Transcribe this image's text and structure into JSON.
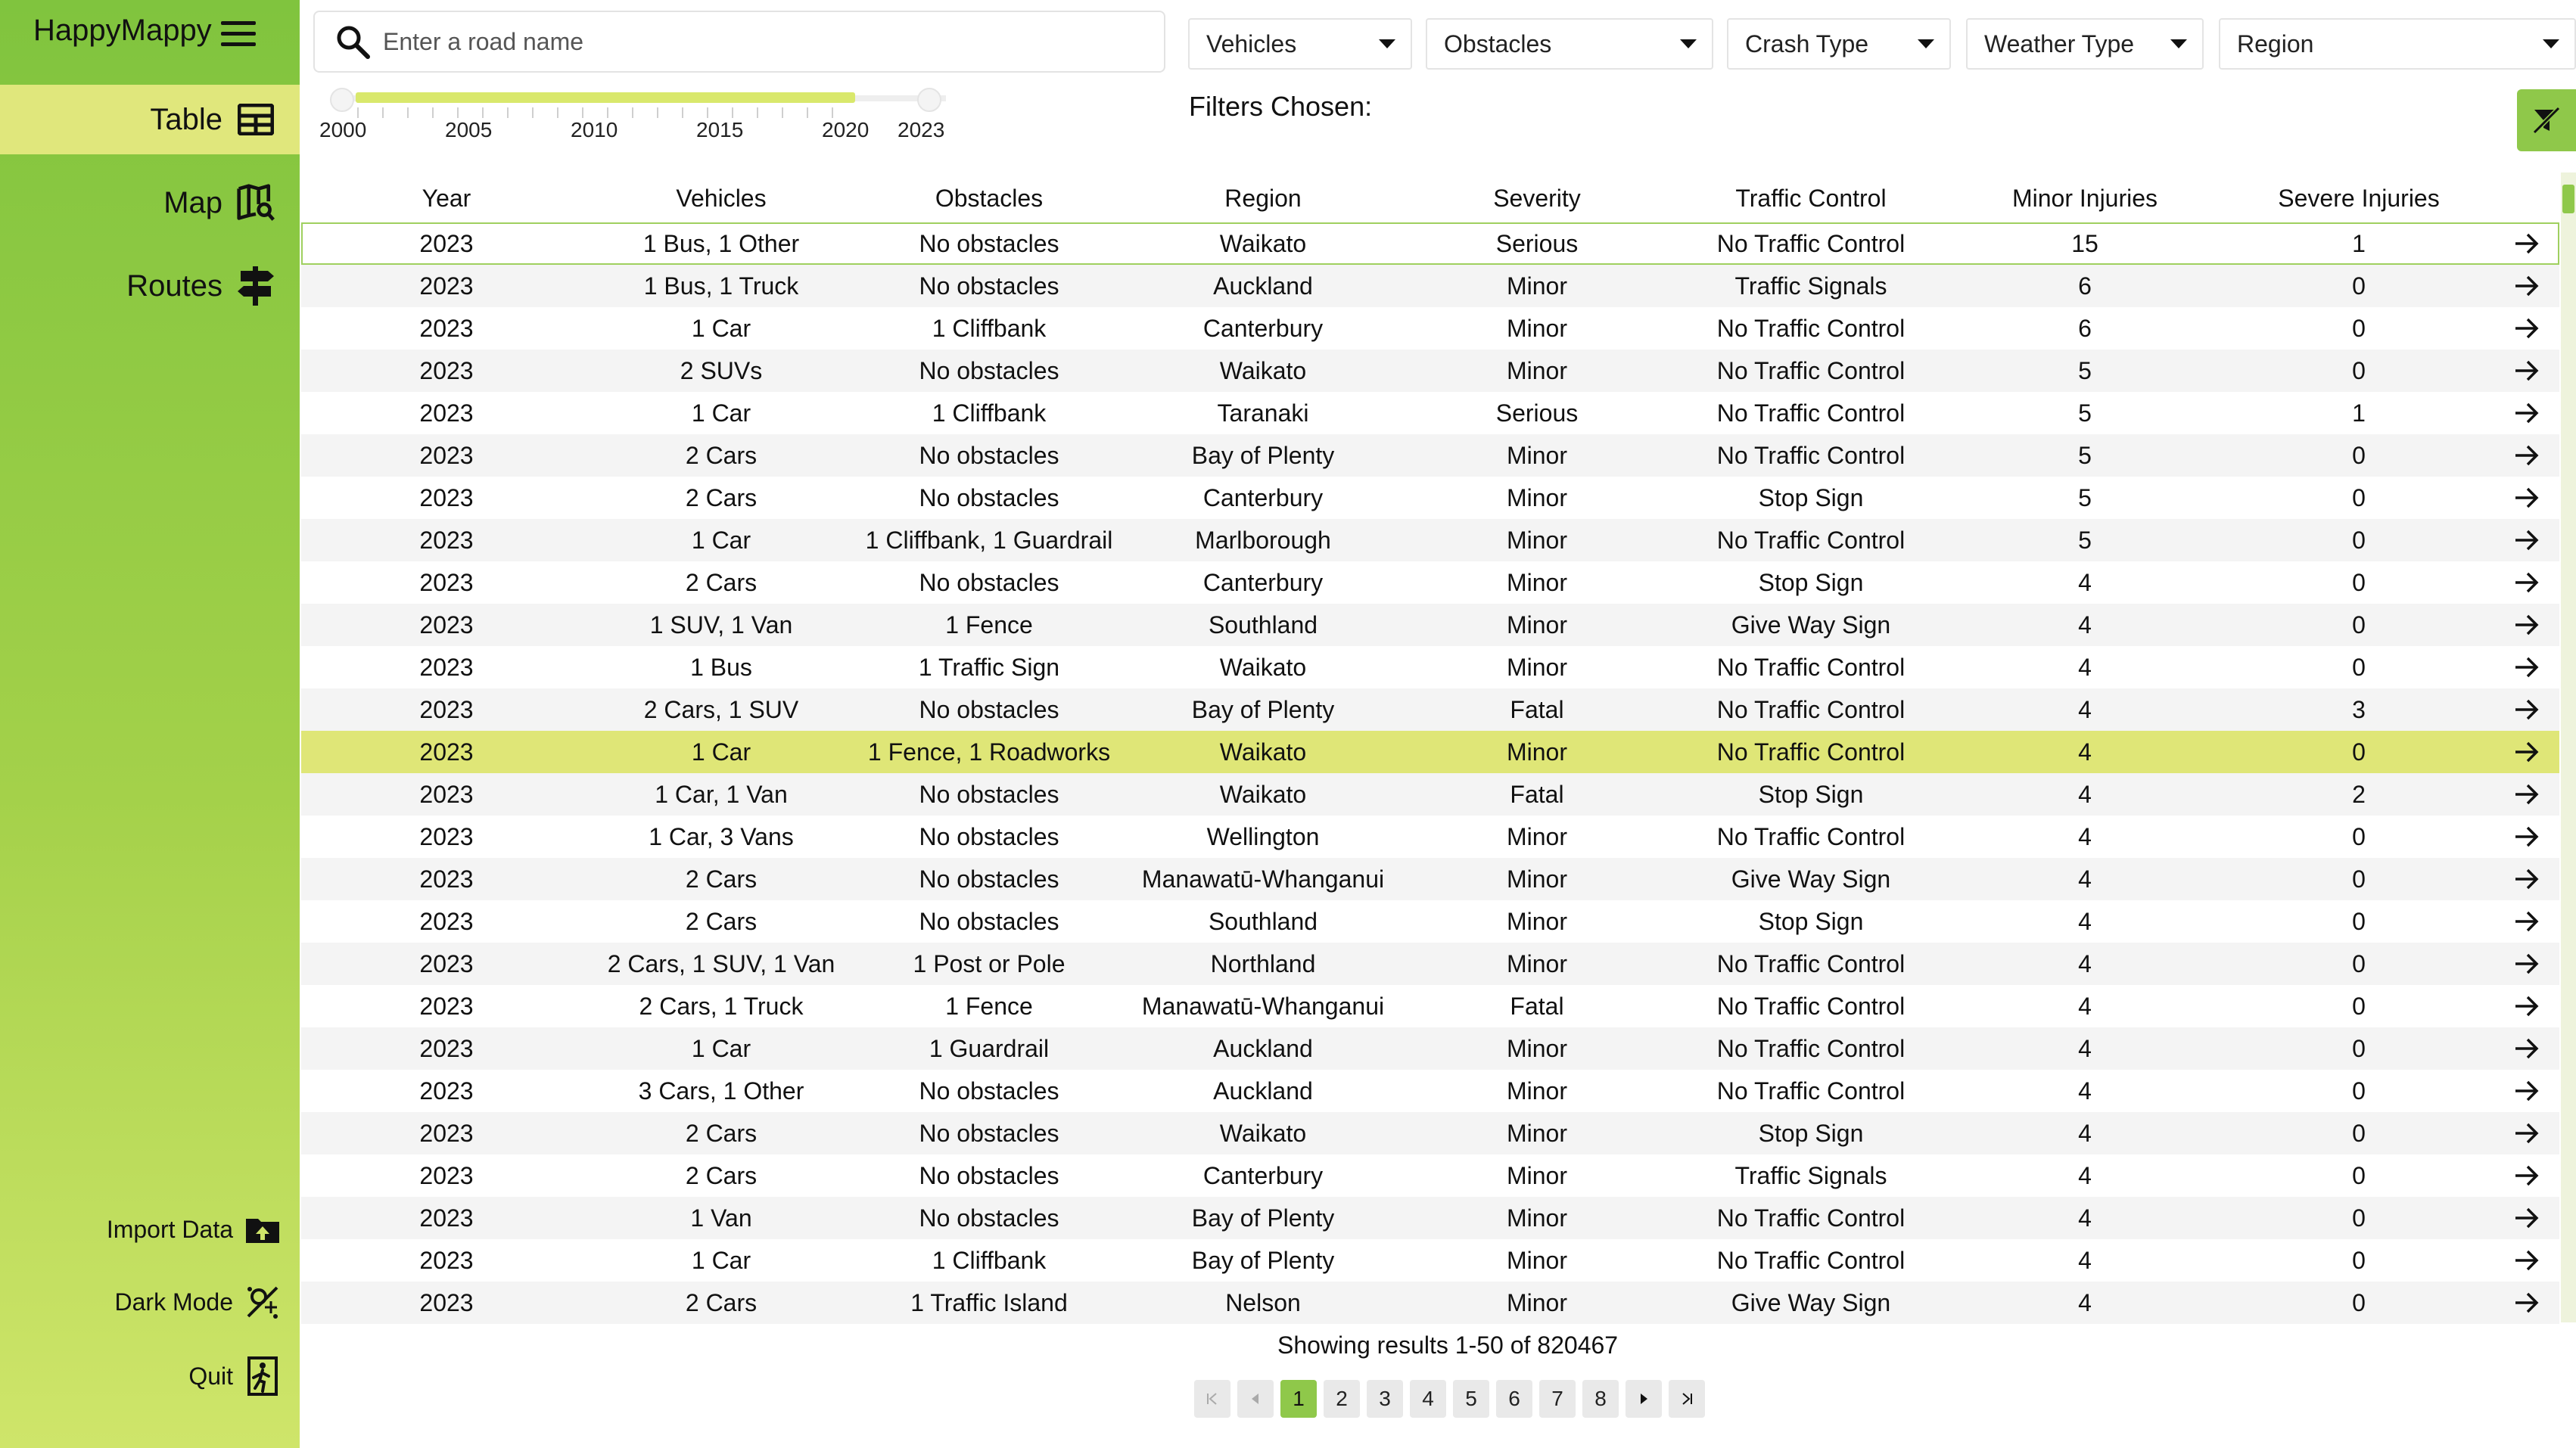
{
  "app": {
    "name": "HappyMappy"
  },
  "sidebar": {
    "nav": [
      {
        "label": "Table",
        "icon": "table-icon",
        "active": true
      },
      {
        "label": "Map",
        "icon": "map-search-icon",
        "active": false
      },
      {
        "label": "Routes",
        "icon": "signpost-icon",
        "active": false
      }
    ],
    "utilities": [
      {
        "label": "Import Data",
        "icon": "folder-upload-icon"
      },
      {
        "label": "Dark Mode",
        "icon": "dark-mode-icon"
      },
      {
        "label": "Quit",
        "icon": "exit-icon"
      }
    ]
  },
  "search": {
    "placeholder": "Enter a road name",
    "value": ""
  },
  "filters": {
    "dropdowns": [
      "Vehicles",
      "Obstacles",
      "Crash Type",
      "Weather Type",
      "Region"
    ],
    "chosen_label": "Filters Chosen:"
  },
  "year_slider": {
    "labels": [
      "2000",
      "2005",
      "2010",
      "2015",
      "2020",
      "2023"
    ],
    "min": 2000,
    "max": 2023,
    "selected_from": 2000,
    "selected_to": 2023
  },
  "table": {
    "columns": [
      "Year",
      "Vehicles",
      "Obstacles",
      "Region",
      "Severity",
      "Traffic Control",
      "Minor Injuries",
      "Severe Injuries"
    ],
    "sorted_columns": [
      "Year",
      "Minor Injuries"
    ],
    "rows": [
      [
        "2023",
        "1 Bus, 1 Other",
        "No obstacles",
        "Waikato",
        "Serious",
        "No Traffic Control",
        "15",
        "1"
      ],
      [
        "2023",
        "1 Bus, 1 Truck",
        "No obstacles",
        "Auckland",
        "Minor",
        "Traffic Signals",
        "6",
        "0"
      ],
      [
        "2023",
        "1 Car",
        "1 Cliffbank",
        "Canterbury",
        "Minor",
        "No Traffic Control",
        "6",
        "0"
      ],
      [
        "2023",
        "2 SUVs",
        "No obstacles",
        "Waikato",
        "Minor",
        "No Traffic Control",
        "5",
        "0"
      ],
      [
        "2023",
        "1 Car",
        "1 Cliffbank",
        "Taranaki",
        "Serious",
        "No Traffic Control",
        "5",
        "1"
      ],
      [
        "2023",
        "2 Cars",
        "No obstacles",
        "Bay of Plenty",
        "Minor",
        "No Traffic Control",
        "5",
        "0"
      ],
      [
        "2023",
        "2 Cars",
        "No obstacles",
        "Canterbury",
        "Minor",
        "Stop Sign",
        "5",
        "0"
      ],
      [
        "2023",
        "1 Car",
        "1 Cliffbank, 1 Guardrail",
        "Marlborough",
        "Minor",
        "No Traffic Control",
        "5",
        "0"
      ],
      [
        "2023",
        "2 Cars",
        "No obstacles",
        "Canterbury",
        "Minor",
        "Stop Sign",
        "4",
        "0"
      ],
      [
        "2023",
        "1 SUV, 1 Van",
        "1 Fence",
        "Southland",
        "Minor",
        "Give Way Sign",
        "4",
        "0"
      ],
      [
        "2023",
        "1 Bus",
        "1 Traffic Sign",
        "Waikato",
        "Minor",
        "No Traffic Control",
        "4",
        "0"
      ],
      [
        "2023",
        "2 Cars, 1 SUV",
        "No obstacles",
        "Bay of Plenty",
        "Fatal",
        "No Traffic Control",
        "4",
        "3"
      ],
      [
        "2023",
        "1 Car",
        "1 Fence, 1 Roadworks",
        "Waikato",
        "Minor",
        "No Traffic Control",
        "4",
        "0"
      ],
      [
        "2023",
        "1 Car, 1 Van",
        "No obstacles",
        "Waikato",
        "Fatal",
        "Stop Sign",
        "4",
        "2"
      ],
      [
        "2023",
        "1 Car, 3 Vans",
        "No obstacles",
        "Wellington",
        "Minor",
        "No Traffic Control",
        "4",
        "0"
      ],
      [
        "2023",
        "2 Cars",
        "No obstacles",
        "Manawatū-Whanganui",
        "Minor",
        "Give Way Sign",
        "4",
        "0"
      ],
      [
        "2023",
        "2 Cars",
        "No obstacles",
        "Southland",
        "Minor",
        "Stop Sign",
        "4",
        "0"
      ],
      [
        "2023",
        "2 Cars, 1 SUV, 1 Van",
        "1 Post or Pole",
        "Northland",
        "Minor",
        "No Traffic Control",
        "4",
        "0"
      ],
      [
        "2023",
        "2 Cars, 1 Truck",
        "1 Fence",
        "Manawatū-Whanganui",
        "Fatal",
        "No Traffic Control",
        "4",
        "0"
      ],
      [
        "2023",
        "1 Car",
        "1 Guardrail",
        "Auckland",
        "Minor",
        "No Traffic Control",
        "4",
        "0"
      ],
      [
        "2023",
        "3 Cars, 1 Other",
        "No obstacles",
        "Auckland",
        "Minor",
        "No Traffic Control",
        "4",
        "0"
      ],
      [
        "2023",
        "2 Cars",
        "No obstacles",
        "Waikato",
        "Minor",
        "Stop Sign",
        "4",
        "0"
      ],
      [
        "2023",
        "2 Cars",
        "No obstacles",
        "Canterbury",
        "Minor",
        "Traffic Signals",
        "4",
        "0"
      ],
      [
        "2023",
        "1 Van",
        "No obstacles",
        "Bay of Plenty",
        "Minor",
        "No Traffic Control",
        "4",
        "0"
      ],
      [
        "2023",
        "1 Car",
        "1 Cliffbank",
        "Bay of Plenty",
        "Minor",
        "No Traffic Control",
        "4",
        "0"
      ],
      [
        "2023",
        "2 Cars",
        "1 Traffic Island",
        "Nelson",
        "Minor",
        "Give Way Sign",
        "4",
        "0"
      ]
    ],
    "selected_row": 12,
    "outlined_row": 0
  },
  "pagination": {
    "results_text": "Showing results 1-50 of 820467",
    "pages": [
      "1",
      "2",
      "3",
      "4",
      "5",
      "6",
      "7",
      "8"
    ],
    "current_page": "1"
  },
  "colors": {
    "sidebar_top": "#80c43e",
    "sidebar_bottom": "#cfe56a",
    "active_nav": "#e0e77c",
    "selected_row": "#dfe677",
    "accent": "#8fc84a"
  }
}
